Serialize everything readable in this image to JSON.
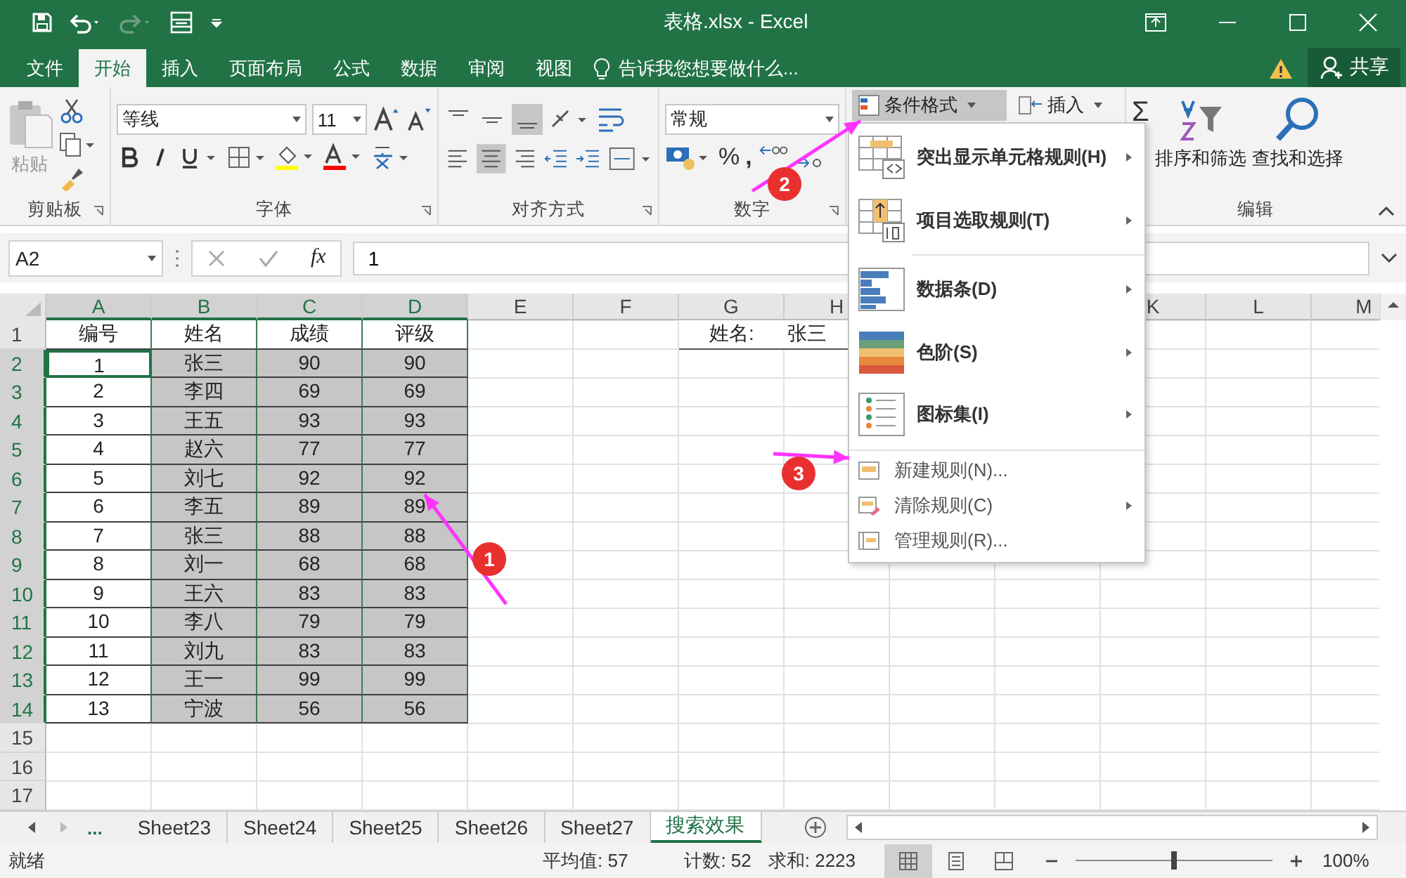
{
  "title_bar": {
    "title": "表格.xlsx - Excel"
  },
  "tabs": [
    {
      "label": "文件",
      "selected": false
    },
    {
      "label": "开始",
      "selected": true
    },
    {
      "label": "插入",
      "selected": false
    },
    {
      "label": "页面布局",
      "selected": false
    },
    {
      "label": "公式",
      "selected": false
    },
    {
      "label": "数据",
      "selected": false
    },
    {
      "label": "审阅",
      "selected": false
    },
    {
      "label": "视图",
      "selected": false
    }
  ],
  "tell_me": {
    "placeholder": "告诉我您想要做什么..."
  },
  "share": {
    "label": "共享"
  },
  "ribbon": {
    "clipboard": {
      "paste": "粘贴",
      "label": "剪贴板"
    },
    "font": {
      "family": "等线",
      "size": "11",
      "label": "字体"
    },
    "alignment": {
      "label": "对齐方式"
    },
    "number": {
      "format": "常规",
      "percent": "%",
      "comma": ",",
      "label": "数字"
    },
    "styles": {
      "conditional_format": "条件格式",
      "pressed": true
    },
    "cells": {
      "insert": "插入"
    },
    "editing": {
      "sum": "Σ",
      "sort_filter": "排序和筛选",
      "find_select": "查找和选择",
      "label": "编辑"
    }
  },
  "formula_bar": {
    "name_box": "A2",
    "fx": "fx",
    "value": "1"
  },
  "sheet": {
    "columns_left": [
      {
        "label": "A",
        "selected": true
      },
      {
        "label": "B",
        "selected": true
      },
      {
        "label": "C",
        "selected": true
      },
      {
        "label": "D",
        "selected": true
      },
      {
        "label": "E",
        "selected": false
      },
      {
        "label": "F",
        "selected": false
      },
      {
        "label": "G",
        "selected": false
      },
      {
        "label": "H",
        "selected": false
      }
    ],
    "columns_right": [
      {
        "label": "K",
        "selected": false
      },
      {
        "label": "L",
        "selected": false
      },
      {
        "label": "M",
        "selected": false
      }
    ],
    "rows": [
      {
        "header": "1",
        "selected": false,
        "shaded": false,
        "cells": [
          "编号",
          "姓名",
          "成绩",
          "评级"
        ],
        "side": [
          "姓名:",
          "张三"
        ]
      },
      {
        "header": "2",
        "selected": true,
        "shaded": true,
        "cells": [
          "1",
          "张三",
          "90",
          "90"
        ]
      },
      {
        "header": "3",
        "selected": true,
        "shaded": true,
        "cells": [
          "2",
          "李四",
          "69",
          "69"
        ]
      },
      {
        "header": "4",
        "selected": true,
        "shaded": true,
        "cells": [
          "3",
          "王五",
          "93",
          "93"
        ]
      },
      {
        "header": "5",
        "selected": true,
        "shaded": true,
        "cells": [
          "4",
          "赵六",
          "77",
          "77"
        ]
      },
      {
        "header": "6",
        "selected": true,
        "shaded": true,
        "cells": [
          "5",
          "刘七",
          "92",
          "92"
        ]
      },
      {
        "header": "7",
        "selected": true,
        "shaded": true,
        "cells": [
          "6",
          "李五",
          "89",
          "89"
        ]
      },
      {
        "header": "8",
        "selected": true,
        "shaded": true,
        "cells": [
          "7",
          "张三",
          "88",
          "88"
        ]
      },
      {
        "header": "9",
        "selected": true,
        "shaded": true,
        "cells": [
          "8",
          "刘一",
          "68",
          "68"
        ]
      },
      {
        "header": "10",
        "selected": true,
        "shaded": true,
        "cells": [
          "9",
          "王六",
          "83",
          "83"
        ]
      },
      {
        "header": "11",
        "selected": true,
        "shaded": true,
        "cells": [
          "10",
          "李八",
          "79",
          "79"
        ]
      },
      {
        "header": "12",
        "selected": true,
        "shaded": true,
        "cells": [
          "11",
          "刘九",
          "83",
          "83"
        ]
      },
      {
        "header": "13",
        "selected": true,
        "shaded": true,
        "cells": [
          "12",
          "王一",
          "99",
          "99"
        ]
      },
      {
        "header": "14",
        "selected": true,
        "shaded": true,
        "cells": [
          "13",
          "宁波",
          "56",
          "56"
        ]
      },
      {
        "header": "15",
        "selected": false
      },
      {
        "header": "16",
        "selected": false
      },
      {
        "header": "17",
        "selected": false
      }
    ]
  },
  "menu": [
    {
      "kind": "highlight",
      "label": "突出显示单元格规则(H)",
      "submenu": true
    },
    {
      "kind": "top",
      "label": "项目选取规则(T)",
      "submenu": true
    },
    {
      "kind": "databar",
      "label": "数据条(D)",
      "submenu": true
    },
    {
      "kind": "scale",
      "label": "色阶(S)",
      "submenu": true
    },
    {
      "kind": "iconset",
      "label": "图标集(I)",
      "submenu": true
    },
    {
      "kind": "new",
      "label": "新建规则(N)...",
      "submenu": false
    },
    {
      "kind": "clear",
      "label": "清除规则(C)",
      "submenu": true
    },
    {
      "kind": "manage",
      "label": "管理规则(R)...",
      "submenu": false
    }
  ],
  "annotations": [
    {
      "label": "1"
    },
    {
      "label": "2"
    },
    {
      "label": "3"
    }
  ],
  "sheet_tabs": {
    "more": "...",
    "tabs": [
      {
        "label": "Sheet23",
        "selected": false
      },
      {
        "label": "Sheet24",
        "selected": false
      },
      {
        "label": "Sheet25",
        "selected": false
      },
      {
        "label": "Sheet26",
        "selected": false
      },
      {
        "label": "Sheet27",
        "selected": false
      },
      {
        "label": "搜索效果",
        "selected": true
      }
    ]
  },
  "status_bar": {
    "ready": "就绪",
    "average": "平均值: 57",
    "count": "计数: 52",
    "sum": "求和: 2223",
    "views": [
      {
        "kind": "normal",
        "selected": true
      },
      {
        "kind": "page_layout",
        "selected": false
      },
      {
        "kind": "page_break",
        "selected": false
      }
    ],
    "zoom": {
      "level": 0.5,
      "label": "100%"
    }
  }
}
